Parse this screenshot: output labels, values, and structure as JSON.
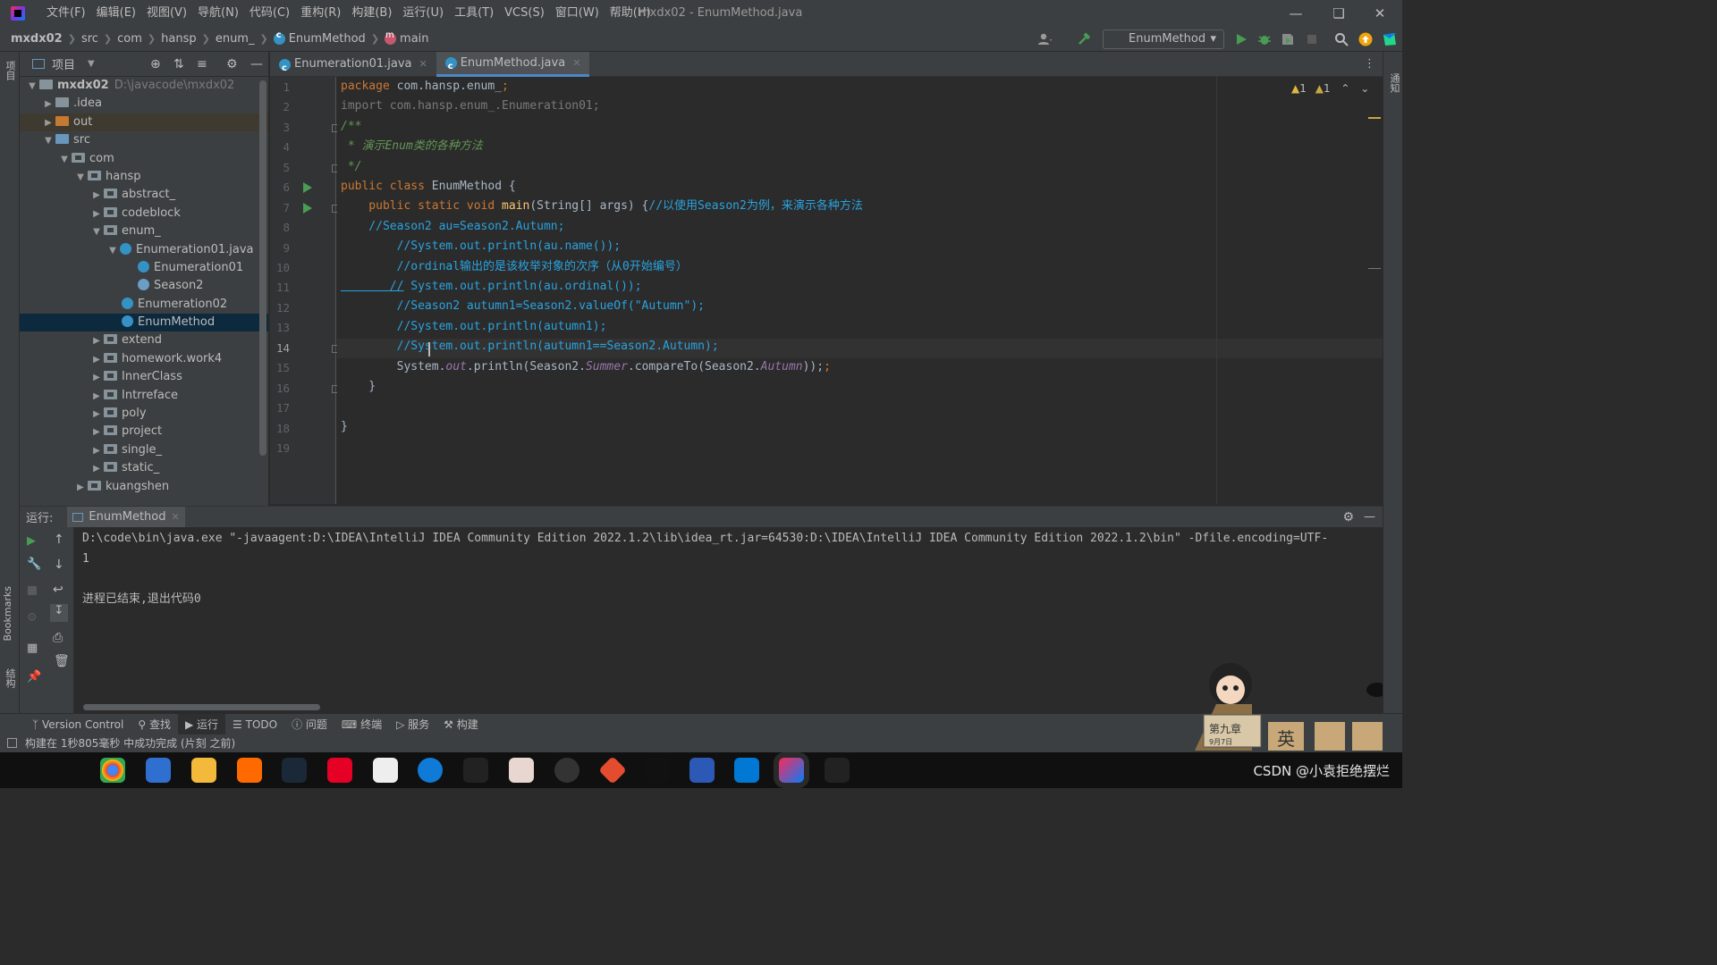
{
  "menu": [
    "文件(F)",
    "编辑(E)",
    "视图(V)",
    "导航(N)",
    "代码(C)",
    "重构(R)",
    "构建(B)",
    "运行(U)",
    "工具(T)",
    "VCS(S)",
    "窗口(W)",
    "帮助(H)"
  ],
  "window_title": "mxdx02 - EnumMethod.java",
  "breadcrumb": [
    "mxdx02",
    "src",
    "com",
    "hansp",
    "enum_",
    "EnumMethod",
    "main"
  ],
  "run_config": "EnumMethod",
  "project_panel": {
    "title": "项目"
  },
  "tree": [
    {
      "label": "mxdx02",
      "path": "D:\\javacode\\mxdx02"
    },
    {
      "label": ".idea"
    },
    {
      "label": "out"
    },
    {
      "label": "src"
    },
    {
      "label": "com"
    },
    {
      "label": "hansp"
    },
    {
      "label": "abstract_"
    },
    {
      "label": "codeblock"
    },
    {
      "label": "enum_"
    },
    {
      "label": "Enumeration01.java"
    },
    {
      "label": "Enumeration01"
    },
    {
      "label": "Season2"
    },
    {
      "label": "Enumeration02"
    },
    {
      "label": "EnumMethod"
    },
    {
      "label": "extend"
    },
    {
      "label": "homework.work4"
    },
    {
      "label": "InnerClass"
    },
    {
      "label": "Intrreface"
    },
    {
      "label": "poly"
    },
    {
      "label": "project"
    },
    {
      "label": "single_"
    },
    {
      "label": "static_"
    },
    {
      "label": "kuangshen"
    }
  ],
  "editor_tabs": [
    "Enumeration01.java",
    "EnumMethod.java"
  ],
  "line_numbers": [
    "1",
    "2",
    "3",
    "4",
    "5",
    "6",
    "7",
    "8",
    "9",
    "10",
    "11",
    "12",
    "13",
    "14",
    "15",
    "16",
    "17",
    "18",
    "19"
  ],
  "code": {
    "l1": [
      "package",
      " com.hansp.enum_",
      ";"
    ],
    "l2": "import com.hansp.enum_.Enumeration01;",
    "l3": "/**",
    "l4": " * 演示Enum类的各种方法",
    "l5": " */",
    "l6": [
      "public class",
      " EnumMethod {"
    ],
    "l7": [
      "    public static void ",
      "main",
      "(String[] args) {",
      "//以使用Season2为例，来演示各种方法"
    ],
    "l8": "    //Season2 au=Season2.Autumn;",
    "l9": "        //System.out.println(au.name());",
    "l10": "        //ordinal输出的是该枚举对象的次序（从0开始编号）",
    "l11": [
      "       //",
      " System.out.println(au.ordinal());"
    ],
    "l12": "        //Season2 autumn1=Season2.valueOf(\"Autumn\");",
    "l13": "        //System.out.println(autumn1);",
    "l14": "        //System.out.println(autumn1==Season2.Autumn);",
    "l15": [
      "        System.",
      "out",
      ".println(Season2.",
      "Summer",
      ".compareTo(Season2.",
      "Autumn",
      "));"
    ],
    "l16": "    }",
    "l18": "}"
  },
  "inspections": {
    "warnings": "1",
    "weak_warnings": "1"
  },
  "run_panel": {
    "label": "运行:",
    "tab": "EnumMethod",
    "console": [
      "D:\\code\\bin\\java.exe \"-javaagent:D:\\IDEA\\IntelliJ IDEA Community Edition 2022.1.2\\lib\\idea_rt.jar=64530:D:\\IDEA\\IntelliJ IDEA Community Edition 2022.1.2\\bin\" -Dfile.encoding=UTF-",
      "1",
      "",
      "进程已结束,退出代码0"
    ]
  },
  "bottom_tabs": [
    "Version Control",
    "查找",
    "运行",
    "TODO",
    "问题",
    "终端",
    "服务",
    "构建"
  ],
  "left_strip_labels": {
    "project": "项目",
    "bookmarks": "Bookmarks",
    "structure": "结构"
  },
  "right_strip_label": "通知",
  "status": "构建在 1秒805毫秒 中成功完成 (片刻 之前)",
  "watermark": "CSDN @小袁拒绝摆烂",
  "mascot_sign": "第九章",
  "mascot_date": "9月7日",
  "mascot_badge": "英"
}
